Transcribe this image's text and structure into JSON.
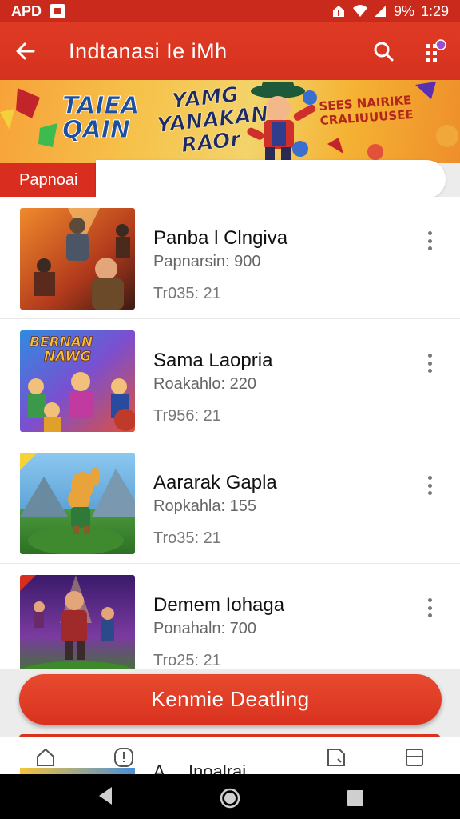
{
  "status_bar": {
    "carrier": "APD",
    "battery": "9%",
    "time": "1:29"
  },
  "app_bar": {
    "title": "Indtanasi  Ie  iMh"
  },
  "banner": {
    "left_line1": "TAIEA",
    "left_line2": "QAIN",
    "mid_line1": "YAMG",
    "mid_line2": "YANAKAN",
    "mid_line3": "RAOr",
    "right_line1": "SEES NAIRIKE",
    "right_line2": "CRALIUUUSEE"
  },
  "section": {
    "tab_label": "Papnoai"
  },
  "games": [
    {
      "title": "Panba l Clngiva",
      "subtitle": "Papnarsin: 900",
      "meta": "Tr035: 21"
    },
    {
      "title": "Sama Laopria",
      "subtitle": "Roakahlo: 220",
      "meta": "Tr956: 21"
    },
    {
      "title": "Aararak Gapla",
      "subtitle": "Ropkahla: 155",
      "meta": "Tro35: 21"
    },
    {
      "title": "Demem Iohaga",
      "subtitle": "Ponahaln: 700",
      "meta": "Tro25: 21"
    }
  ],
  "thumbnails": {
    "thumb2_text_line1": "BERNAN",
    "thumb2_text_line2": "NAWG"
  },
  "cta": {
    "label": "Kenmie Deatling"
  },
  "bottom_peek": {
    "text": "A ... Inoalrai"
  },
  "colors": {
    "primary": "#d5321f",
    "status_bar": "#c92a1c",
    "banner_gold": "#f6c24a"
  }
}
